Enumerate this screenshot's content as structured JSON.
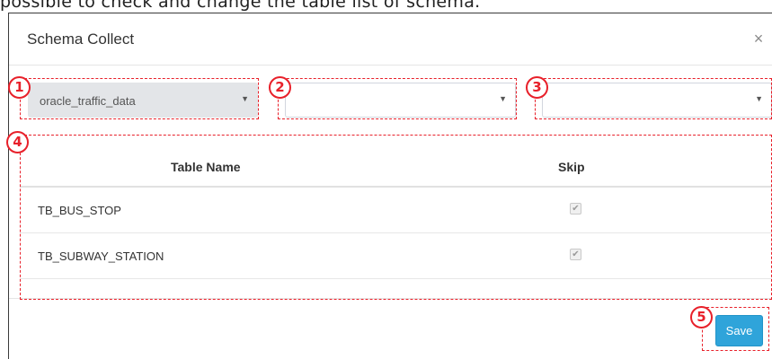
{
  "caption": "possible to check and change the table list of schema.",
  "modal": {
    "title": "Schema Collect",
    "close_glyph": "×"
  },
  "selects": [
    {
      "value": "oracle_traffic_data",
      "arrow": "▼"
    },
    {
      "value": "",
      "arrow": "▼"
    },
    {
      "value": "",
      "arrow": "▼"
    }
  ],
  "table": {
    "headers": [
      "Table Name",
      "Skip"
    ],
    "rows": [
      {
        "name": "TB_BUS_STOP",
        "skip_checked": true,
        "check_glyph": "✔"
      },
      {
        "name": "TB_SUBWAY_STATION",
        "skip_checked": true,
        "check_glyph": "✔"
      }
    ]
  },
  "footer": {
    "save_label": "Save"
  },
  "annotations": [
    "1",
    "2",
    "3",
    "4",
    "5"
  ],
  "colors": {
    "annotation_red": "#e8202a",
    "primary_button": "#2fa4da",
    "disabled_select": "#e3e5e8"
  }
}
